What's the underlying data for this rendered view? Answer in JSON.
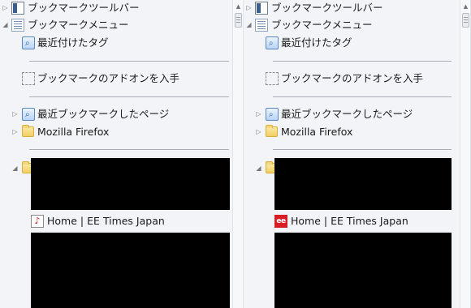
{
  "left": {
    "toolbar": "ブックマークツールバー",
    "menu": "ブックマークメニュー",
    "recent_tags": "最近付けたタグ",
    "addons": "ブックマークのアドオンを入手",
    "recent_pages": "最近ブックマークしたページ",
    "firefox": "Mozilla Firefox",
    "ee_link": "Home | EE Times Japan",
    "ee_favicon_glyph": "♪"
  },
  "right": {
    "toolbar": "ブックマークツールバー",
    "menu": "ブックマークメニュー",
    "recent_tags": "最近付けたタグ",
    "addons": "ブックマークのアドオンを入手",
    "recent_pages": "最近ブックマークしたページ",
    "firefox": "Mozilla Firefox",
    "ee_link": "Home | EE Times Japan",
    "ee_favicon_glyph": "ee"
  },
  "icons": {
    "expander_collapsed": "▷",
    "expander_expanded": "◢",
    "search_glyph": "⌕",
    "scroll_up": "▲"
  }
}
